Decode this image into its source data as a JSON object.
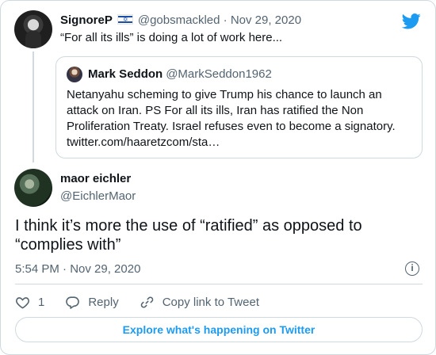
{
  "parent_tweet": {
    "name": "SignoreP",
    "flag_icon": "israel-flag-icon",
    "handle": "@gobsmackled",
    "separator": "·",
    "date": "Nov 29, 2020",
    "text": "“For all its ills” is doing a lot of work here..."
  },
  "quoted_tweet": {
    "name": "Mark Seddon",
    "handle": "@MarkSeddon1962",
    "text": "Netanyahu scheming to give Trump his chance to launch an attack on Iran.  PS For all its ills, Iran has ratified the Non Proliferation Treaty. Israel refuses even to become a signatory. twitter.com/haaretzcom/sta…"
  },
  "main_tweet": {
    "name": "maor eichler",
    "handle": "@EichlerMaor",
    "text": "I think it’s more the use of “ratified” as opposed to “complies with”",
    "timestamp": "5:54 PM · Nov 29, 2020",
    "info_icon": "i"
  },
  "actions": {
    "like_count": "1",
    "reply_label": "Reply",
    "copy_label": "Copy link to Tweet"
  },
  "explore_label": "Explore what's happening on Twitter",
  "colors": {
    "accent": "#1d9bf0",
    "secondary_text": "#536471",
    "border": "#cfd9de"
  }
}
